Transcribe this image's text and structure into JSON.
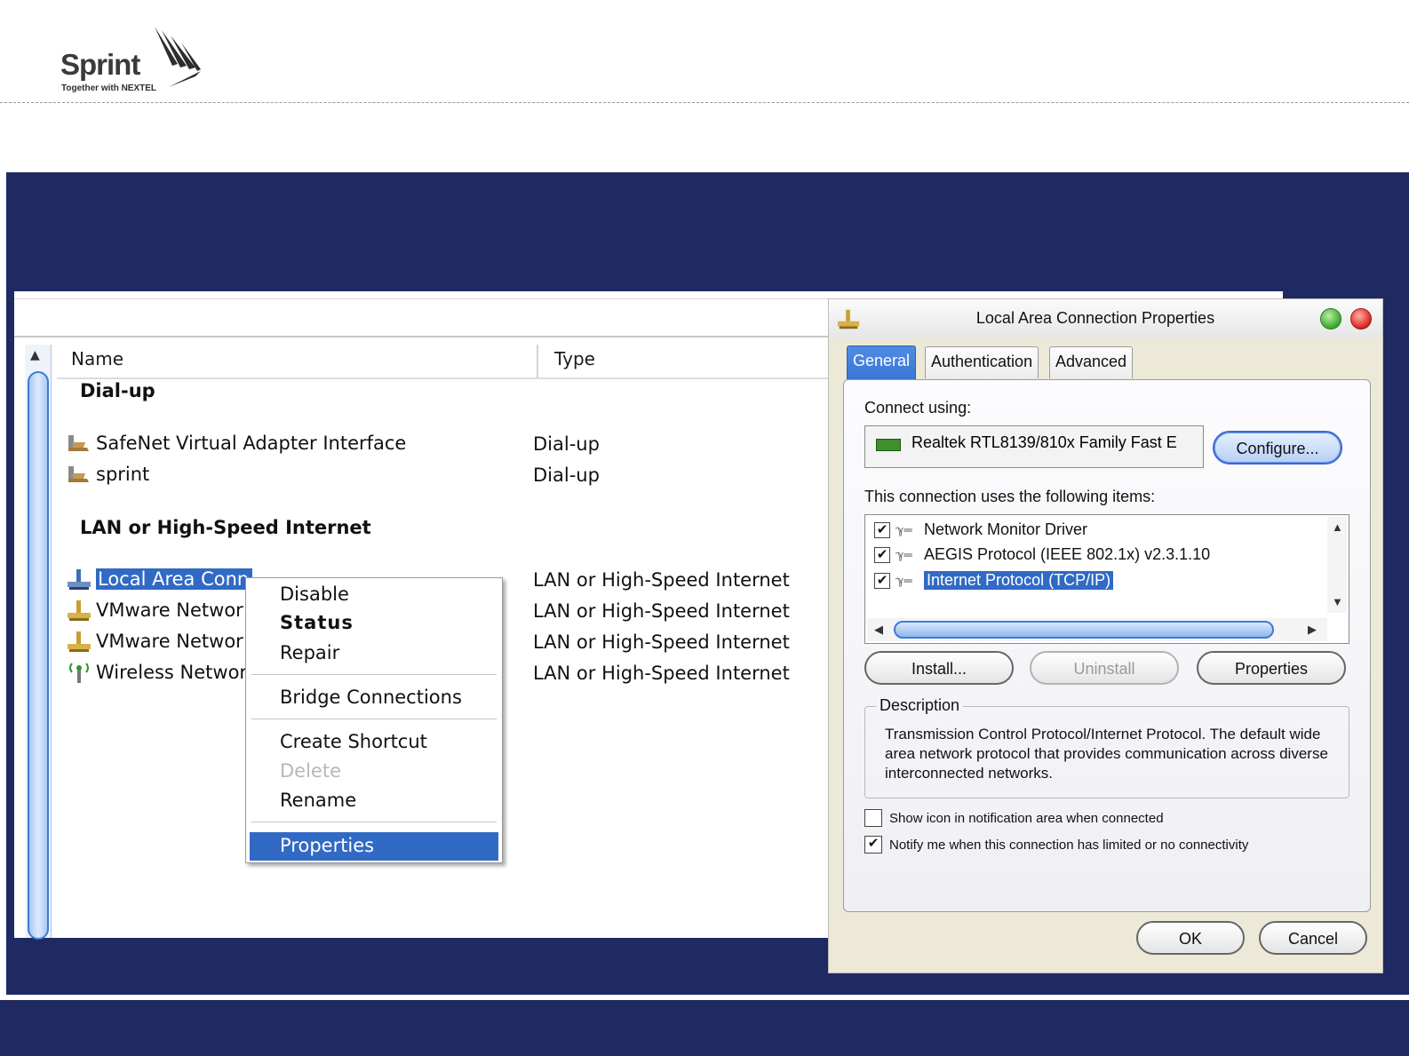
{
  "header": {
    "logo_word": "Sprint",
    "logo_tagline": "Together with NEXTEL"
  },
  "explorer": {
    "columns": [
      "Name",
      "Type"
    ],
    "groups": [
      {
        "label": "Dial-up"
      },
      {
        "label": "LAN or High-Speed Internet"
      }
    ],
    "rows": [
      {
        "name": "SafeNet Virtual Adapter Interface",
        "type": "Dial-up",
        "icon": "dialup-connection-icon"
      },
      {
        "name": "sprint",
        "type": "Dial-up",
        "icon": "dialup-connection-icon"
      },
      {
        "name": "Local Area Conn",
        "type": "LAN or High-Speed Internet",
        "icon": "lan-connection-icon",
        "selected": true
      },
      {
        "name": "VMware Networ",
        "type": "LAN or High-Speed Internet",
        "icon": "lan-connection-icon"
      },
      {
        "name": "VMware Networ",
        "type": "LAN or High-Speed Internet",
        "icon": "lan-connection-icon"
      },
      {
        "name": "Wireless Networ",
        "type": "LAN or High-Speed Internet",
        "icon": "wireless-connection-icon"
      }
    ]
  },
  "context_menu": {
    "items": [
      {
        "label": "Disable"
      },
      {
        "label": "Status",
        "bold": true
      },
      {
        "label": "Repair"
      },
      {
        "label": "Bridge Connections"
      },
      {
        "label": "Create Shortcut"
      },
      {
        "label": "Delete",
        "disabled": true
      },
      {
        "label": "Rename"
      },
      {
        "label": "Properties",
        "highlighted": true
      }
    ]
  },
  "dialog": {
    "title": "Local Area Connection Properties",
    "tabs": [
      "General",
      "Authentication",
      "Advanced"
    ],
    "active_tab": "General",
    "connect_using_label": "Connect using:",
    "adapter_name": "Realtek RTL8139/810x Family Fast E",
    "configure_button": "Configure...",
    "items_label": "This connection uses the following items:",
    "items": [
      {
        "label": "Network Monitor Driver",
        "checked": true
      },
      {
        "label": "AEGIS Protocol (IEEE 802.1x) v2.3.1.10",
        "checked": true
      },
      {
        "label": "Internet Protocol (TCP/IP)",
        "checked": true,
        "selected": true
      }
    ],
    "install_button": "Install...",
    "uninstall_button": "Uninstall",
    "properties_button": "Properties",
    "description_legend": "Description",
    "description_text": "Transmission Control Protocol/Internet Protocol. The default wide area network protocol that provides communication across diverse interconnected networks.",
    "show_icon_label": "Show icon in notification area when connected",
    "show_icon_checked": false,
    "notify_label": "Notify me when this connection has limited or no connectivity",
    "notify_checked": true,
    "ok_button": "OK",
    "cancel_button": "Cancel"
  },
  "colors": {
    "band": "#1f2a63",
    "selection": "#316ac5"
  }
}
